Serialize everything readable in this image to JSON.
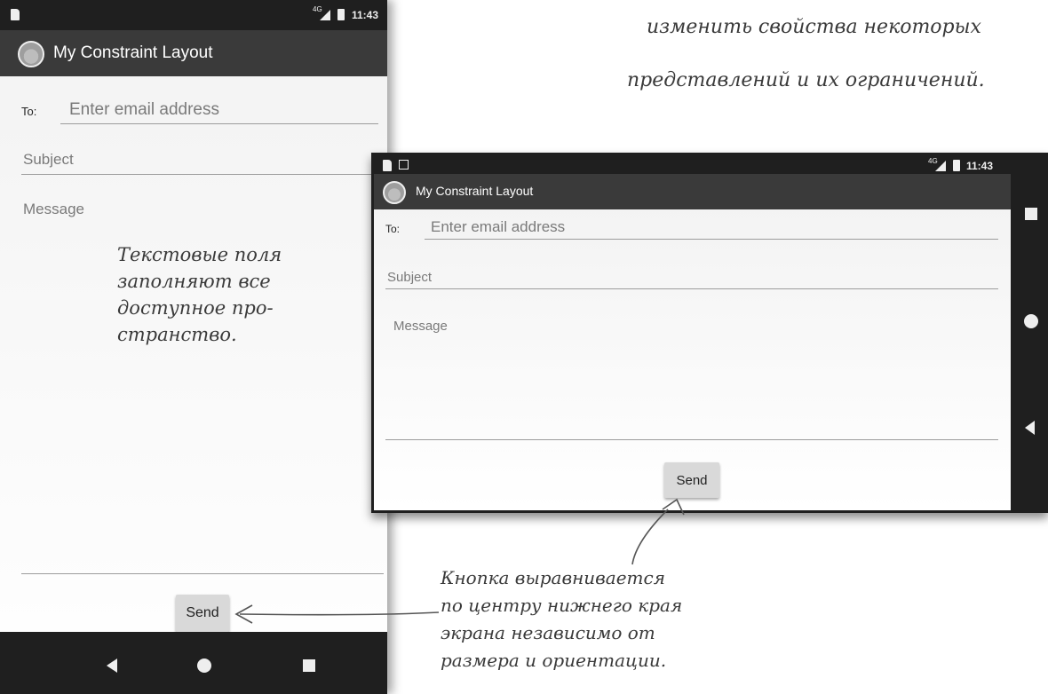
{
  "top_note": {
    "line1": "изменить свойства некоторых",
    "line2": "представлений и их ограничений."
  },
  "portrait": {
    "status": {
      "time": "11:43",
      "network": "4G"
    },
    "app_title": "My Constraint Layout",
    "to_label": "To:",
    "email_placeholder": "Enter email address",
    "subject_placeholder": "Subject",
    "message_placeholder": "Message",
    "send_label": "Send",
    "nav": {
      "back": "back-icon",
      "home": "home-icon",
      "recents": "recents-icon"
    }
  },
  "landscape": {
    "status": {
      "time": "11:43",
      "network": "4G"
    },
    "app_title": "My Constraint Layout",
    "to_label": "To:",
    "email_placeholder": "Enter email address",
    "subject_placeholder": "Subject",
    "message_placeholder": "Message",
    "send_label": "Send"
  },
  "annotations": {
    "fields_note": "Текстовые поля\nзаполняют все\nдоступное про-\nстранство.",
    "button_note": "Кнопка выравнивается\nпо центру нижнего края\nэкрана независимо от\nразмера и ориентации."
  }
}
